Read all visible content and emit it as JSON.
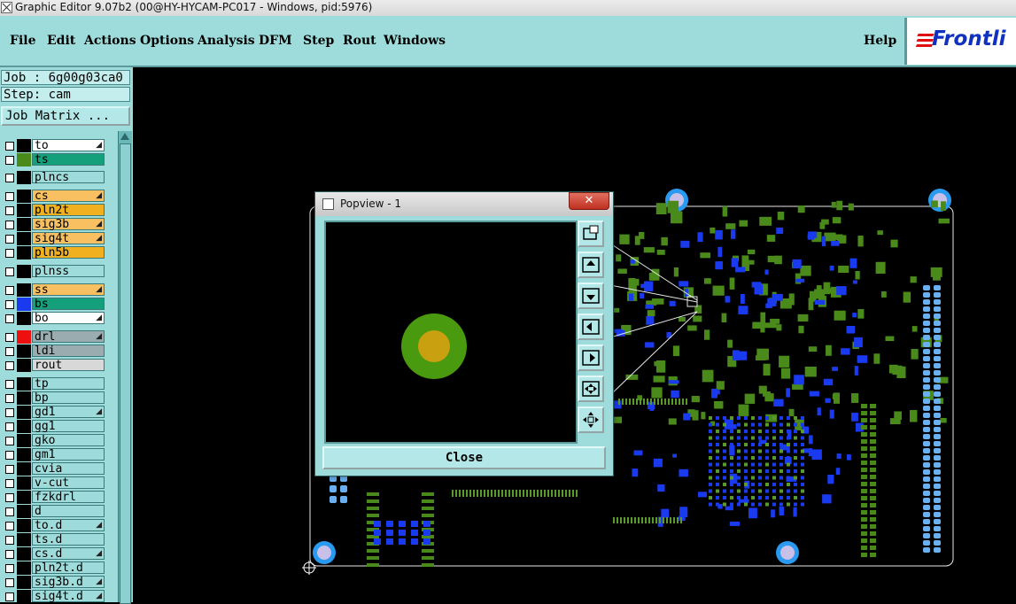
{
  "window": {
    "title": "Graphic Editor 9.07b2 (00@HY-HYCAM-PC017 - Windows, pid:5976)"
  },
  "menu": {
    "items": [
      "File",
      "Edit",
      "Actions",
      "Options",
      "Analysis",
      "DFM",
      "Step",
      "Rout",
      "Windows"
    ],
    "help": "Help"
  },
  "logo": {
    "text": "Frontli"
  },
  "job": {
    "label": "Job : 6g00g03ca0",
    "step": "Step: cam",
    "matrix_button": "Job Matrix ..."
  },
  "layers": [
    {
      "name": "to",
      "color": "#ffffff",
      "swatch": "#000000",
      "editable": true
    },
    {
      "name": "ts",
      "color": "#13a07a",
      "swatch": "#4a8a1a",
      "editable": false
    },
    {
      "name": "plncs",
      "color": "#9edcdc",
      "swatch": "#000000",
      "editable": false
    },
    {
      "name": "cs",
      "color": "#f8c060",
      "swatch": "#000000",
      "editable": true
    },
    {
      "name": "pln2t",
      "color": "#f0b020",
      "swatch": "#000000",
      "editable": false
    },
    {
      "name": "sig3b",
      "color": "#f8c060",
      "swatch": "#000000",
      "editable": true
    },
    {
      "name": "sig4t",
      "color": "#f8c060",
      "swatch": "#000000",
      "editable": true
    },
    {
      "name": "pln5b",
      "color": "#f0b020",
      "swatch": "#000000",
      "editable": false
    },
    {
      "name": "plnss",
      "color": "#9edcdc",
      "swatch": "#000000",
      "editable": false
    },
    {
      "name": "ss",
      "color": "#f8c060",
      "swatch": "#000000",
      "editable": true
    },
    {
      "name": "bs",
      "color": "#13a07a",
      "swatch": "#1a3af0",
      "editable": false
    },
    {
      "name": "bo",
      "color": "#ffffff",
      "swatch": "#000000",
      "editable": true
    },
    {
      "name": "drl",
      "color": "#9aacb0",
      "swatch": "#ee1010",
      "editable": true
    },
    {
      "name": "ldi",
      "color": "#9aacb0",
      "swatch": "#000000",
      "editable": false
    },
    {
      "name": "rout",
      "color": "#d8d8d8",
      "swatch": "#000000",
      "editable": false
    },
    {
      "name": "tp",
      "color": "#9edcdc",
      "swatch": "#000000",
      "editable": false
    },
    {
      "name": "bp",
      "color": "#9edcdc",
      "swatch": "#000000",
      "editable": false
    },
    {
      "name": "gd1",
      "color": "#9edcdc",
      "swatch": "#000000",
      "editable": true
    },
    {
      "name": "gg1",
      "color": "#9edcdc",
      "swatch": "#000000",
      "editable": false
    },
    {
      "name": "gko",
      "color": "#9edcdc",
      "swatch": "#000000",
      "editable": false
    },
    {
      "name": "gm1",
      "color": "#9edcdc",
      "swatch": "#000000",
      "editable": false
    },
    {
      "name": "cvia",
      "color": "#9edcdc",
      "swatch": "#000000",
      "editable": false
    },
    {
      "name": "v-cut",
      "color": "#9edcdc",
      "swatch": "#000000",
      "editable": false
    },
    {
      "name": "fzkdrl",
      "color": "#9edcdc",
      "swatch": "#000000",
      "editable": false
    },
    {
      "name": "d",
      "color": "#9edcdc",
      "swatch": "#000000",
      "editable": false
    },
    {
      "name": "to.d",
      "color": "#9edcdc",
      "swatch": "#000000",
      "editable": true
    },
    {
      "name": "ts.d",
      "color": "#9edcdc",
      "swatch": "#000000",
      "editable": false
    },
    {
      "name": "cs.d",
      "color": "#9edcdc",
      "swatch": "#000000",
      "editable": true
    },
    {
      "name": "pln2t.d",
      "color": "#9edcdc",
      "swatch": "#000000",
      "editable": false
    },
    {
      "name": "sig3b.d",
      "color": "#9edcdc",
      "swatch": "#000000",
      "editable": true
    },
    {
      "name": "sig4t.d",
      "color": "#9edcdc",
      "swatch": "#000000",
      "editable": true
    }
  ],
  "popview": {
    "title": "Popview - 1",
    "close_label": "Close",
    "tools": [
      "zoom-box-icon",
      "pan-up-icon",
      "pan-down-icon",
      "pan-left-icon",
      "pan-right-icon",
      "zoom-out-icon",
      "fit-icon"
    ]
  },
  "colors": {
    "panel": "#9edcdc",
    "pad_green": "#4a8a1a",
    "pad_blue": "#1a3af0",
    "pad_lightblue": "#6ab0f0",
    "drill_gold": "#c89a10"
  }
}
